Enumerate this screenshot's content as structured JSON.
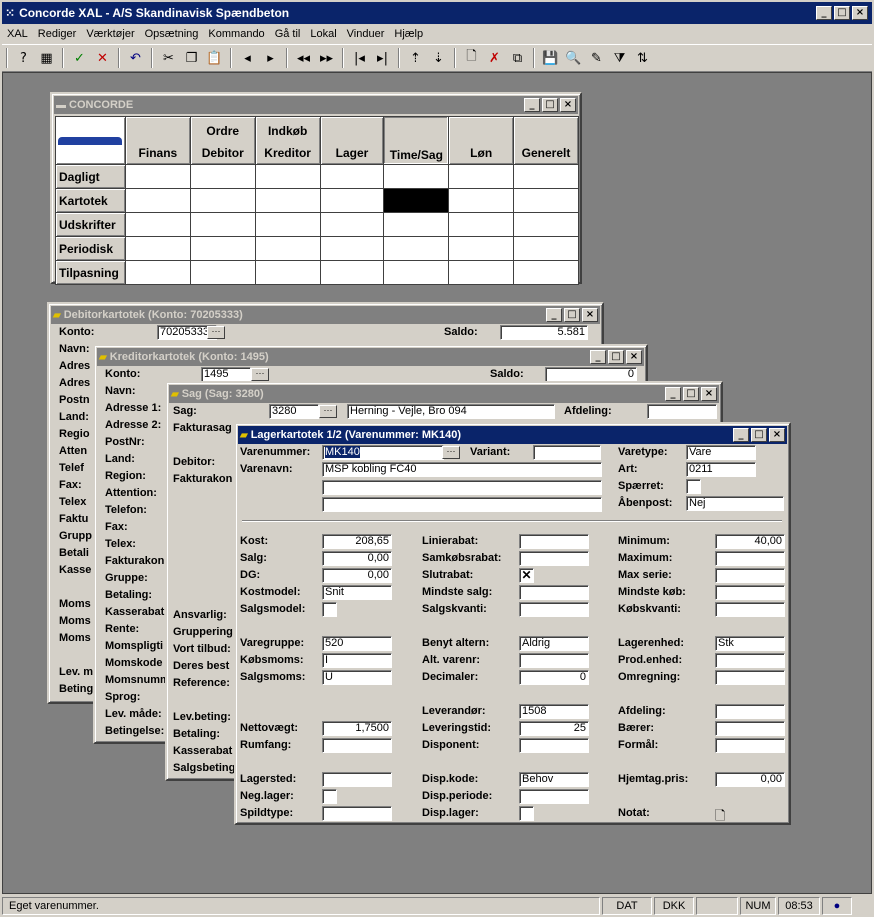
{
  "app": {
    "title": "Concorde XAL - A/S Skandinavisk Spændbeton"
  },
  "menu": [
    "XAL",
    "Rediger",
    "Værktøjer",
    "Opsætning",
    "Kommando",
    "Gå til",
    "Lokal",
    "Vinduer",
    "Hjælp"
  ],
  "status": {
    "message": "Eget varenummer.",
    "p1": "DAT",
    "p2": "DKK",
    "p3": "NUM",
    "time": "08:53"
  },
  "concorde": {
    "title": "CONCORDE",
    "cols": [
      [
        "",
        ""
      ],
      [
        "",
        "Finans"
      ],
      [
        "Ordre",
        "Debitor"
      ],
      [
        "Indkøb",
        "Kreditor"
      ],
      [
        "",
        "Lager"
      ],
      [
        "",
        "Time/Sag"
      ],
      [
        "",
        "Løn"
      ],
      [
        "",
        "Generelt"
      ]
    ],
    "rows": [
      "Dagligt",
      "Kartotek",
      "Udskrifter",
      "Periodisk",
      "Tilpasning"
    ]
  },
  "debitor": {
    "title": "Debitorkartotek (Konto: 70205333)",
    "konto_lbl": "Konto:",
    "konto": "70205333",
    "saldo_lbl": "Saldo:",
    "saldo": "5.581",
    "labels": [
      "Navn:",
      "Adres",
      "Adres",
      "Postn",
      "Land:",
      "Regio",
      "Atten",
      "Telef",
      "Fax:",
      "Telex",
      "Faktu",
      "Grupp",
      "Betali",
      "Kasse",
      "Moms",
      "Moms",
      "Moms",
      "Lev. m",
      "Beting"
    ]
  },
  "kreditor": {
    "title": "Kreditorkartotek (Konto: 1495)",
    "konto_lbl": "Konto:",
    "konto": "1495",
    "saldo_lbl": "Saldo:",
    "saldo": "0",
    "labels": [
      "Navn:",
      "Adresse 1:",
      "Adresse 2:",
      "PostNr:",
      "Land:",
      "Region:",
      "Attention:",
      "Telefon:",
      "Fax:",
      "Telex:",
      "Fakturakon",
      "Gruppe:",
      "Betaling:",
      "Kasserabat",
      "Rente:",
      "Momspligti",
      "Momskode",
      "Momsnumm",
      "Sprog:",
      "Lev. måde:",
      "Betingelse:"
    ]
  },
  "sag": {
    "title": "Sag (Sag: 3280)",
    "sag_lbl": "Sag:",
    "sag": "3280",
    "name": "Herning - Vejle, Bro 094",
    "afd_lbl": "Afdeling:",
    "labels_top": [
      "Fakturasag",
      "Debitor:",
      "Fakturakon"
    ],
    "labels_bot": [
      "Ansvarlig:",
      "Gruppering",
      "Vort tilbud:",
      "Deres best",
      "Reference:",
      "Lev.beting:",
      "Betaling:",
      "Kasserabat",
      "Salgsbeting"
    ]
  },
  "lager": {
    "title": "Lagerkartotek 1/2 (Varenummer: MK140)",
    "varenr_lbl": "Varenummer:",
    "varenr": "MK140",
    "variant_lbl": "Variant:",
    "varenavn_lbl": "Varenavn:",
    "varenavn": "MSP kobling FC40",
    "varetype_lbl": "Varetype:",
    "varetype": "Vare",
    "art_lbl": "Art:",
    "art": "0211",
    "spaerret_lbl": "Spærret:",
    "aabenpost_lbl": "Åbenpost:",
    "aabenpost": "Nej",
    "col1": [
      {
        "l": "Kost:",
        "v": "208,65",
        "r": true
      },
      {
        "l": "Salg:",
        "v": "0,00",
        "r": true
      },
      {
        "l": "DG:",
        "v": "0,00",
        "r": true
      },
      {
        "l": "Kostmodel:",
        "v": "Snit"
      },
      {
        "l": "Salgsmodel:",
        "chk": true
      },
      {
        "l": "Varegruppe:",
        "v": "520"
      },
      {
        "l": "Købsmoms:",
        "v": "I"
      },
      {
        "l": "Salgsmoms:",
        "v": "U"
      },
      {
        "l": "Nettovægt:",
        "v": "1,7500",
        "r": true
      },
      {
        "l": "Rumfang:",
        "v": ""
      },
      {
        "l": "Lagersted:",
        "v": ""
      },
      {
        "l": "Neg.lager:",
        "chk": true
      },
      {
        "l": "Spildtype:",
        "v": ""
      }
    ],
    "col2": [
      {
        "l": "Linierabat:",
        "v": ""
      },
      {
        "l": "Samkøbsrabat:",
        "v": ""
      },
      {
        "l": "Slutrabat:",
        "x": "✕"
      },
      {
        "l": "Mindste salg:",
        "v": ""
      },
      {
        "l": "Salgskvanti:",
        "v": ""
      },
      {
        "l": "Benyt altern:",
        "v": "Aldrig"
      },
      {
        "l": "Alt. varenr:",
        "v": ""
      },
      {
        "l": "Decimaler:",
        "v": "0",
        "r": true
      },
      {
        "l": "Leverandør:",
        "v": "1508"
      },
      {
        "l": "Leveringstid:",
        "v": "25",
        "r": true
      },
      {
        "l": "Disponent:",
        "v": ""
      },
      {
        "l": "Disp.kode:",
        "v": "Behov"
      },
      {
        "l": "Disp.periode:",
        "v": ""
      },
      {
        "l": "Disp.lager:",
        "chk": true
      }
    ],
    "col3": [
      {
        "l": "Minimum:",
        "v": "40,00",
        "r": true
      },
      {
        "l": "Maximum:",
        "v": ""
      },
      {
        "l": "Max serie:",
        "v": ""
      },
      {
        "l": "Mindste køb:",
        "v": ""
      },
      {
        "l": "Købskvanti:",
        "v": ""
      },
      {
        "l": "Lagerenhed:",
        "v": "Stk"
      },
      {
        "l": "Prod.enhed:",
        "v": ""
      },
      {
        "l": "Omregning:",
        "v": ""
      },
      {
        "l": "Afdeling:",
        "v": ""
      },
      {
        "l": "Bærer:",
        "v": ""
      },
      {
        "l": "Formål:",
        "v": ""
      },
      {
        "l": "Hjemtag.pris:",
        "v": "0,00",
        "r": true
      },
      {
        "l": "Notat:",
        "icon": "note-icon"
      }
    ]
  }
}
